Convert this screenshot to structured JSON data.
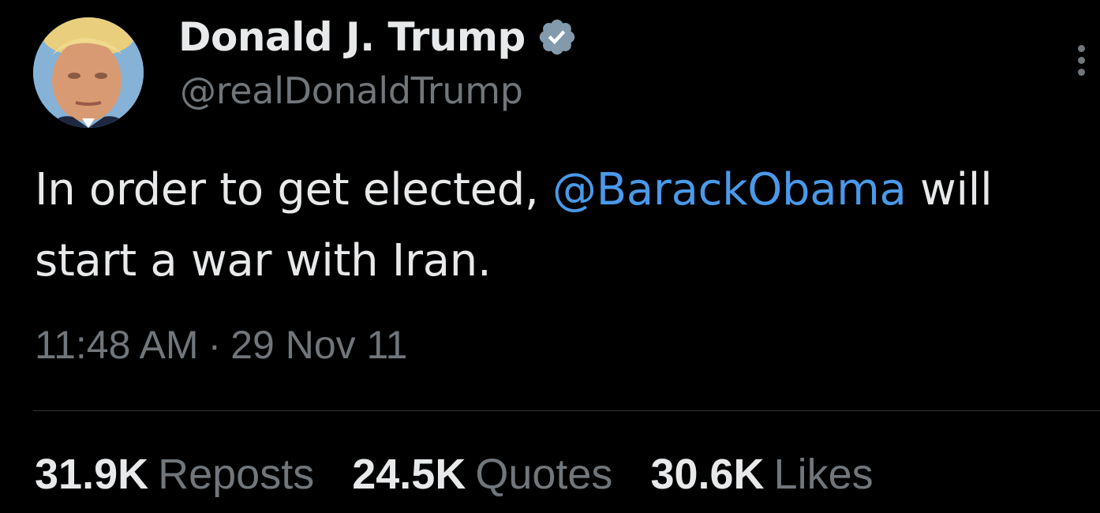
{
  "author": {
    "display_name": "Donald J. Trump",
    "handle": "@realDonaldTrump",
    "verified_badge_icon": "verified-badge-icon"
  },
  "tweet": {
    "text_before": "In order to get elected, ",
    "mention": "@BarackObama",
    "text_after": " will start a war with Iran.",
    "time": "11:48 AM",
    "separator": "·",
    "date": "29 Nov 11"
  },
  "stats": [
    {
      "count": "31.9K",
      "label": "Reposts"
    },
    {
      "count": "24.5K",
      "label": "Quotes"
    },
    {
      "count": "30.6K",
      "label": "Likes"
    }
  ],
  "colors": {
    "background": "#000000",
    "primary_text": "#e7e9ea",
    "secondary_text": "#71767b",
    "link": "#4a99e9",
    "divider": "#2f3336",
    "badge": "#829aab"
  },
  "icons": {
    "more": "more-horizontal-icon",
    "badge": "verified-badge-icon"
  }
}
